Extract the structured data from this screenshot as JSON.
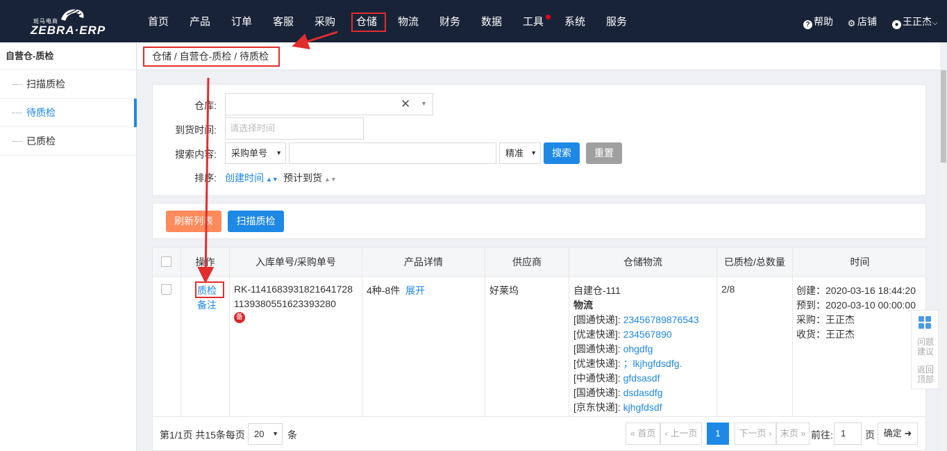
{
  "app": {
    "logo_sub": "斑马电商",
    "logo_main": "ZEBRA·ERP"
  },
  "nav": {
    "items": [
      "首页",
      "产品",
      "订单",
      "客服",
      "采购",
      "仓储",
      "物流",
      "财务",
      "数据",
      "工具",
      "系统",
      "服务"
    ],
    "active": "仓储",
    "right": {
      "help": "帮助",
      "shop": "店铺",
      "user": "王正杰"
    }
  },
  "sidebar": {
    "title": "自营仓-质检",
    "items": [
      {
        "label": "扫描质检"
      },
      {
        "label": "待质检",
        "active": true
      },
      {
        "label": "已质检"
      }
    ]
  },
  "breadcrumb": "仓储 / 自营仓-质检 / 待质检",
  "filter": {
    "warehouse_label": "仓库:",
    "arrival_label": "到货时间:",
    "arrival_placeholder": "请选择时间",
    "search_label": "搜索内容:",
    "search_type": "采购单号",
    "match_mode": "精准",
    "search_button": "搜索",
    "reset_button": "重置",
    "sort_label": "排序:",
    "sort_created": "创建时间",
    "sort_expected": "预计到货"
  },
  "actions": {
    "refresh": "刷新列表",
    "scan": "扫描质检"
  },
  "table": {
    "headers": [
      "操作",
      "入库单号/采购单号",
      "产品详情",
      "供应商",
      "仓储物流",
      "已质检/总数量",
      "时间"
    ],
    "row": {
      "op_inspect": "质检",
      "op_note": "备注",
      "inbound_no": "RK-1141683931821641728",
      "purchase_no": "1139380551623393280",
      "note_badge": "备",
      "product_summary": "4种-8件",
      "product_expand": "展开",
      "supplier": "好莱坞",
      "warehouse": "自建仓-111",
      "logistics_label": "物流",
      "logistics": [
        {
          "carrier": "[圆通快递]:",
          "no": "23456789876543"
        },
        {
          "carrier": "[优速快递]:",
          "no": "234567890"
        },
        {
          "carrier": "[圆通快递]:",
          "no": "ohgdfg"
        },
        {
          "carrier": "[优速快递]:",
          "no": "；lkjhgfdsdfg."
        },
        {
          "carrier": "[中通快递]:",
          "no": "gfdsasdf"
        },
        {
          "carrier": "[国通快递]:",
          "no": "dsdasdfg"
        },
        {
          "carrier": "[京东快递]:",
          "no": "kjhgfdsdf"
        }
      ],
      "qty": "2/8",
      "times": [
        "创建：2020-03-16 18:44:20",
        "预到：2020-03-10 00:00:00",
        "采购：王正杰",
        "收货：王正杰"
      ]
    }
  },
  "pagination": {
    "summary": "第1/1页 共15条每页",
    "page_size": "20",
    "unit": "条",
    "first": "« 首页",
    "prev": "‹ 上一页",
    "current": "1",
    "next": "下一页 ›",
    "last": "末页 »",
    "goto_label": "前往:",
    "goto_value": "1",
    "page_unit": "页",
    "confirm": "确定 ➜"
  },
  "float": {
    "feedback": "问题建议",
    "top": "返回顶部"
  },
  "colors": {
    "nav_bg": "#192338",
    "primary": "#1e88e5",
    "orange": "#ff8a5b",
    "gray_btn": "#a0a0a0",
    "annotation_red": "#e12d2d"
  }
}
